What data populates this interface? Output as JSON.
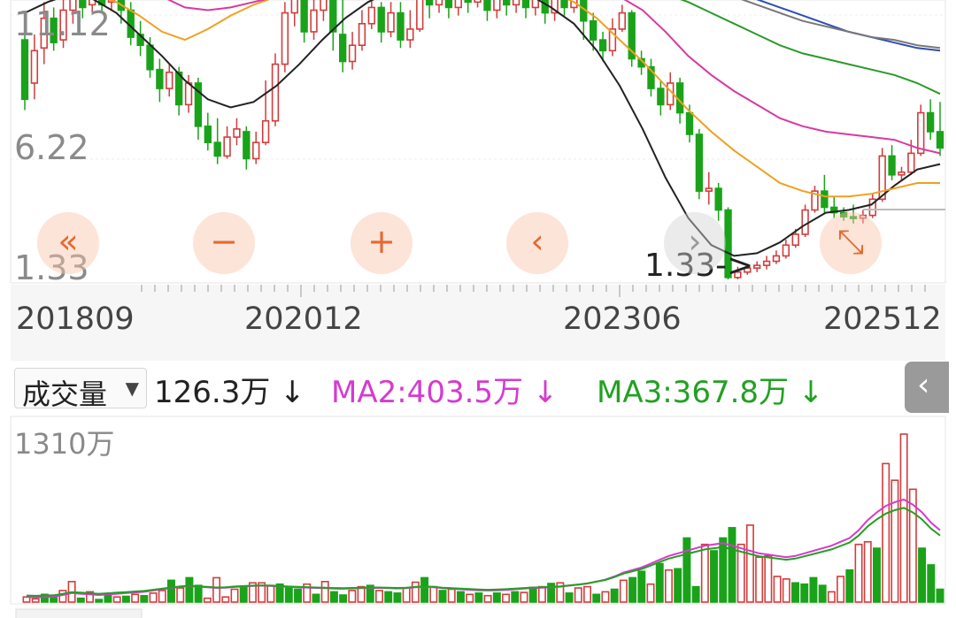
{
  "price_axis": {
    "top": "11.12",
    "mid": "6.22",
    "bottom": "1.33"
  },
  "low_marker": "1.33->",
  "date_labels": [
    "201809",
    "202012",
    "202306",
    "202512"
  ],
  "volume_panel": {
    "selector_label": "成交量",
    "selector_arrow": "▼",
    "vol_text": "126.3万 ↓",
    "ma2_text": "MA2:403.5万 ↓",
    "ma3_text": "MA3:367.8万 ↓",
    "max_label": "1310万",
    "collapse_icon": "‹"
  },
  "controls": [
    {
      "name": "fast-back",
      "icon": "«"
    },
    {
      "name": "zoom-out",
      "icon": "−"
    },
    {
      "name": "zoom-in",
      "icon": "+"
    },
    {
      "name": "back",
      "icon": "‹"
    },
    {
      "name": "forward",
      "icon": "›"
    },
    {
      "name": "expand",
      "icon": "⤡"
    }
  ],
  "colors": {
    "up": "#d23c3c",
    "down": "#1aa31a",
    "ma_black": "#222222",
    "ma_orange": "#f0a020",
    "ma_pink": "#d63aa0",
    "ma_green": "#2a9a2a",
    "ma_blue": "#2d4fb0",
    "ma_gray": "#777777"
  },
  "chart_data": [
    {
      "type": "candlestick",
      "title": "",
      "ylim": [
        1.33,
        11.12
      ],
      "x_tick_labels": [
        "201809",
        "202012",
        "202306",
        "202512"
      ],
      "candles": [
        {
          "o": 10.2,
          "c": 8.0,
          "h": 11.0,
          "l": 7.6
        },
        {
          "o": 8.6,
          "c": 9.8,
          "h": 10.4,
          "l": 8.0
        },
        {
          "o": 9.9,
          "c": 11.0,
          "h": 11.6,
          "l": 9.3
        },
        {
          "o": 11.0,
          "c": 10.1,
          "h": 11.4,
          "l": 9.8
        },
        {
          "o": 10.2,
          "c": 11.3,
          "h": 11.8,
          "l": 9.9
        },
        {
          "o": 11.3,
          "c": 11.8,
          "h": 12.0,
          "l": 10.8
        },
        {
          "o": 11.9,
          "c": 11.4,
          "h": 12.0,
          "l": 11.0
        },
        {
          "o": 11.5,
          "c": 11.9,
          "h": 12.0,
          "l": 11.2
        },
        {
          "o": 11.9,
          "c": 11.5,
          "h": 12.0,
          "l": 11.2
        },
        {
          "o": 11.6,
          "c": 11.9,
          "h": 12.0,
          "l": 11.3
        },
        {
          "o": 11.9,
          "c": 11.3,
          "h": 12.0,
          "l": 10.8
        },
        {
          "o": 11.3,
          "c": 10.3,
          "h": 11.6,
          "l": 10.0
        },
        {
          "o": 10.4,
          "c": 10.0,
          "h": 10.9,
          "l": 9.6
        },
        {
          "o": 10.0,
          "c": 9.1,
          "h": 10.3,
          "l": 8.8
        },
        {
          "o": 9.1,
          "c": 8.4,
          "h": 9.5,
          "l": 7.9
        },
        {
          "o": 8.4,
          "c": 9.0,
          "h": 9.3,
          "l": 8.1
        },
        {
          "o": 9.0,
          "c": 7.8,
          "h": 9.2,
          "l": 7.4
        },
        {
          "o": 7.8,
          "c": 8.6,
          "h": 8.9,
          "l": 7.5
        },
        {
          "o": 8.6,
          "c": 7.0,
          "h": 8.8,
          "l": 6.5
        },
        {
          "o": 7.0,
          "c": 6.4,
          "h": 7.5,
          "l": 6.1
        },
        {
          "o": 6.4,
          "c": 5.9,
          "h": 7.3,
          "l": 5.6
        },
        {
          "o": 5.9,
          "c": 6.6,
          "h": 7.0,
          "l": 5.8
        },
        {
          "o": 6.6,
          "c": 6.9,
          "h": 7.3,
          "l": 6.3
        },
        {
          "o": 6.8,
          "c": 5.8,
          "h": 7.0,
          "l": 5.4
        },
        {
          "o": 5.8,
          "c": 6.4,
          "h": 6.8,
          "l": 5.6
        },
        {
          "o": 6.4,
          "c": 7.2,
          "h": 8.7,
          "l": 6.3
        },
        {
          "o": 7.2,
          "c": 9.3,
          "h": 9.7,
          "l": 7.0
        },
        {
          "o": 9.3,
          "c": 11.2,
          "h": 11.6,
          "l": 9.0
        },
        {
          "o": 11.2,
          "c": 11.8,
          "h": 12.0,
          "l": 10.7
        },
        {
          "o": 11.8,
          "c": 10.5,
          "h": 12.0,
          "l": 10.1
        },
        {
          "o": 10.5,
          "c": 11.3,
          "h": 11.8,
          "l": 10.2
        },
        {
          "o": 11.3,
          "c": 12.0,
          "h": 12.0,
          "l": 10.9
        },
        {
          "o": 12.0,
          "c": 10.5,
          "h": 12.0,
          "l": 9.8
        },
        {
          "o": 10.4,
          "c": 9.4,
          "h": 11.8,
          "l": 9.0
        },
        {
          "o": 9.4,
          "c": 10.0,
          "h": 10.5,
          "l": 9.1
        },
        {
          "o": 10.0,
          "c": 10.8,
          "h": 11.3,
          "l": 9.8
        },
        {
          "o": 10.8,
          "c": 11.4,
          "h": 11.8,
          "l": 10.6
        },
        {
          "o": 11.4,
          "c": 10.5,
          "h": 11.6,
          "l": 10.1
        },
        {
          "o": 10.5,
          "c": 11.2,
          "h": 11.6,
          "l": 10.3
        },
        {
          "o": 11.2,
          "c": 10.2,
          "h": 11.6,
          "l": 9.9
        },
        {
          "o": 10.2,
          "c": 10.6,
          "h": 11.3,
          "l": 9.9
        },
        {
          "o": 10.6,
          "c": 11.9,
          "h": 12.0,
          "l": 10.5
        },
        {
          "o": 11.9,
          "c": 11.5,
          "h": 12.0,
          "l": 11.0
        },
        {
          "o": 11.5,
          "c": 12.0,
          "h": 12.0,
          "l": 11.2
        },
        {
          "o": 12.0,
          "c": 11.4,
          "h": 12.0,
          "l": 11.0
        },
        {
          "o": 11.4,
          "c": 12.0,
          "h": 12.0,
          "l": 11.1
        },
        {
          "o": 12.0,
          "c": 11.6,
          "h": 12.0,
          "l": 11.2
        },
        {
          "o": 11.6,
          "c": 12.0,
          "h": 12.0,
          "l": 11.4
        },
        {
          "o": 12.0,
          "c": 11.3,
          "h": 12.0,
          "l": 10.9
        },
        {
          "o": 11.3,
          "c": 12.0,
          "h": 12.0,
          "l": 11.0
        },
        {
          "o": 12.0,
          "c": 11.5,
          "h": 12.0,
          "l": 11.1
        },
        {
          "o": 11.5,
          "c": 12.0,
          "h": 12.0,
          "l": 11.2
        },
        {
          "o": 12.0,
          "c": 11.4,
          "h": 12.0,
          "l": 11.0
        },
        {
          "o": 11.4,
          "c": 12.0,
          "h": 12.0,
          "l": 11.1
        },
        {
          "o": 12.0,
          "c": 11.2,
          "h": 12.0,
          "l": 10.8
        },
        {
          "o": 11.2,
          "c": 11.9,
          "h": 12.0,
          "l": 10.9
        },
        {
          "o": 11.9,
          "c": 11.4,
          "h": 12.0,
          "l": 11.1
        },
        {
          "o": 11.4,
          "c": 12.0,
          "h": 12.0,
          "l": 11.2
        },
        {
          "o": 12.0,
          "c": 10.9,
          "h": 12.0,
          "l": 10.2
        },
        {
          "o": 10.9,
          "c": 10.2,
          "h": 11.2,
          "l": 9.8
        },
        {
          "o": 10.2,
          "c": 9.8,
          "h": 10.5,
          "l": 9.4
        },
        {
          "o": 9.8,
          "c": 10.6,
          "h": 11.0,
          "l": 9.6
        },
        {
          "o": 10.6,
          "c": 11.2,
          "h": 11.5,
          "l": 10.5
        },
        {
          "o": 11.2,
          "c": 9.5,
          "h": 11.3,
          "l": 9.2
        },
        {
          "o": 9.5,
          "c": 9.2,
          "h": 9.8,
          "l": 8.9
        },
        {
          "o": 9.2,
          "c": 8.4,
          "h": 9.5,
          "l": 8.1
        },
        {
          "o": 8.4,
          "c": 7.8,
          "h": 8.7,
          "l": 7.4
        },
        {
          "o": 7.8,
          "c": 8.6,
          "h": 9.0,
          "l": 7.6
        },
        {
          "o": 8.6,
          "c": 7.5,
          "h": 8.8,
          "l": 7.1
        },
        {
          "o": 7.5,
          "c": 6.7,
          "h": 7.8,
          "l": 6.4
        },
        {
          "o": 6.7,
          "c": 4.6,
          "h": 6.9,
          "l": 4.3
        },
        {
          "o": 4.6,
          "c": 4.7,
          "h": 5.3,
          "l": 4.1
        },
        {
          "o": 4.7,
          "c": 3.9,
          "h": 4.9,
          "l": 3.5
        },
        {
          "o": 3.9,
          "c": 1.4,
          "h": 4.0,
          "l": 1.33
        },
        {
          "o": 1.4,
          "c": 1.6,
          "h": 1.8,
          "l": 1.33
        },
        {
          "o": 1.6,
          "c": 1.75,
          "h": 1.9,
          "l": 1.5
        },
        {
          "o": 1.75,
          "c": 1.85,
          "h": 2.0,
          "l": 1.6
        },
        {
          "o": 1.85,
          "c": 2.0,
          "h": 2.2,
          "l": 1.7
        },
        {
          "o": 2.0,
          "c": 2.2,
          "h": 2.4,
          "l": 1.9
        },
        {
          "o": 2.2,
          "c": 2.6,
          "h": 2.8,
          "l": 2.1
        },
        {
          "o": 2.6,
          "c": 3.0,
          "h": 3.2,
          "l": 2.5
        },
        {
          "o": 3.0,
          "c": 3.9,
          "h": 4.1,
          "l": 2.9
        },
        {
          "o": 3.9,
          "c": 4.6,
          "h": 4.8,
          "l": 3.8
        },
        {
          "o": 4.6,
          "c": 4.0,
          "h": 5.2,
          "l": 3.8
        },
        {
          "o": 4.0,
          "c": 3.8,
          "h": 4.4,
          "l": 3.6
        },
        {
          "o": 3.8,
          "c": 3.65,
          "h": 4.0,
          "l": 3.5
        },
        {
          "o": 3.65,
          "c": 3.6,
          "h": 4.1,
          "l": 3.4
        },
        {
          "o": 3.6,
          "c": 3.7,
          "h": 3.9,
          "l": 3.4
        },
        {
          "o": 3.7,
          "c": 4.3,
          "h": 4.5,
          "l": 3.6
        },
        {
          "o": 4.3,
          "c": 5.9,
          "h": 6.2,
          "l": 4.2
        },
        {
          "o": 5.9,
          "c": 5.2,
          "h": 6.3,
          "l": 5.0
        },
        {
          "o": 5.2,
          "c": 5.3,
          "h": 5.5,
          "l": 5.0
        },
        {
          "o": 5.3,
          "c": 6.0,
          "h": 6.5,
          "l": 5.2
        },
        {
          "o": 6.0,
          "c": 7.5,
          "h": 7.8,
          "l": 5.9
        },
        {
          "o": 7.5,
          "c": 6.8,
          "h": 8.0,
          "l": 6.5
        },
        {
          "o": 6.8,
          "c": 6.2,
          "h": 7.9,
          "l": 5.9
        }
      ],
      "moving_averages": [
        {
          "color": "#222222",
          "values": [
            11.2,
            11.6,
            11.9,
            11.7,
            11.2,
            10.4,
            9.6,
            8.7,
            8.0,
            7.7,
            7.9,
            8.5,
            9.3,
            10.2,
            11.0,
            11.6,
            12.0,
            12.0,
            12.0,
            12.0,
            12.0,
            12.0,
            11.9,
            11.4,
            10.8,
            9.8,
            8.5,
            6.9,
            5.1,
            3.6,
            2.6,
            2.2,
            2.3,
            2.7,
            3.3,
            3.8,
            3.9,
            4.1,
            4.8,
            5.4,
            5.6
          ]
        },
        {
          "color": "#f0a020",
          "values": [
            12.0,
            12.0,
            12.0,
            11.9,
            11.6,
            11.1,
            10.5,
            10.2,
            10.6,
            11.1,
            11.5,
            11.8,
            12.0,
            12.0,
            12.0,
            12.0,
            12.0,
            12.0,
            12.0,
            12.0,
            12.0,
            12.0,
            12.0,
            12.0,
            11.6,
            11.0,
            10.2,
            9.4,
            8.5,
            7.6,
            6.8,
            6.1,
            5.5,
            4.9,
            4.6,
            4.4,
            4.4,
            4.5,
            4.7,
            4.9,
            4.9
          ]
        },
        {
          "color": "#d63aa0",
          "values": [
            12.0,
            12.0,
            12.0,
            12.0,
            12.0,
            12.0,
            11.8,
            11.4,
            11.3,
            11.4,
            11.6,
            11.8,
            12.0,
            12.0,
            12.0,
            12.0,
            12.0,
            12.0,
            12.0,
            12.0,
            12.0,
            12.0,
            12.0,
            12.0,
            12.0,
            12.0,
            11.8,
            11.3,
            10.5,
            9.6,
            8.9,
            8.3,
            7.8,
            7.3,
            7.0,
            6.8,
            6.7,
            6.6,
            6.5,
            6.2,
            6.0
          ]
        },
        {
          "color": "#2a9a2a",
          "values": [
            12.0,
            12.0,
            12.0,
            12.0,
            12.0,
            12.0,
            12.0,
            12.0,
            12.0,
            12.0,
            12.0,
            12.0,
            12.0,
            12.0,
            12.0,
            12.0,
            12.0,
            12.0,
            12.0,
            12.0,
            12.0,
            12.0,
            12.0,
            12.0,
            12.0,
            12.0,
            12.0,
            12.0,
            11.9,
            11.6,
            11.2,
            10.8,
            10.4,
            10.0,
            9.7,
            9.5,
            9.3,
            9.1,
            8.9,
            8.6,
            8.2
          ]
        },
        {
          "color": "#2d4fb0",
          "values": [
            12.0,
            12.0,
            12.0,
            12.0,
            12.0,
            12.0,
            12.0,
            12.0,
            12.0,
            12.0,
            12.0,
            12.0,
            12.0,
            12.0,
            12.0,
            12.0,
            12.0,
            12.0,
            12.0,
            12.0,
            12.0,
            12.0,
            12.0,
            12.0,
            12.0,
            12.0,
            12.0,
            12.0,
            12.0,
            12.0,
            12.0,
            11.9,
            11.7,
            11.4,
            11.1,
            10.8,
            10.5,
            10.3,
            10.1,
            9.9,
            9.8
          ]
        },
        {
          "color": "#777777",
          "values": [
            12.0,
            12.0,
            12.0,
            12.0,
            12.0,
            12.0,
            12.0,
            12.0,
            12.0,
            12.0,
            12.0,
            12.0,
            12.0,
            12.0,
            12.0,
            12.0,
            12.0,
            12.0,
            12.0,
            12.0,
            12.0,
            12.0,
            12.0,
            12.0,
            12.0,
            12.0,
            12.0,
            12.0,
            12.0,
            12.0,
            12.0,
            11.8,
            11.5,
            11.2,
            10.9,
            10.7,
            10.5,
            10.3,
            10.2,
            10.0,
            9.9
          ]
        }
      ]
    },
    {
      "type": "bar",
      "title": "",
      "ylim": [
        0,
        1310
      ],
      "y_unit": "万",
      "values": [
        40,
        25,
        60,
        35,
        90,
        160,
        30,
        80,
        20,
        50,
        40,
        45,
        60,
        50,
        70,
        90,
        170,
        110,
        190,
        130,
        30,
        190,
        40,
        100,
        120,
        150,
        150,
        130,
        140,
        120,
        100,
        140,
        60,
        160,
        80,
        55,
        90,
        120,
        130,
        90,
        80,
        70,
        110,
        155,
        190,
        120,
        90,
        100,
        80,
        60,
        70,
        50,
        70,
        60,
        80,
        75,
        115,
        120,
        145,
        150,
        70,
        110,
        120,
        60,
        80,
        100,
        170,
        190,
        240,
        140,
        300,
        250,
        260,
        500,
        120,
        450,
        400,
        500,
        580,
        450,
        600,
        350,
        360,
        200,
        180,
        150,
        140,
        190,
        130,
        80,
        200,
        250,
        450,
        470,
        420,
        1080,
        950,
        1310,
        880,
        420,
        290,
        100
      ],
      "ups": [
        1,
        1,
        0,
        0,
        1,
        1,
        0,
        1,
        0,
        0,
        1,
        0,
        1,
        0,
        1,
        1,
        0,
        1,
        0,
        0,
        1,
        1,
        1,
        1,
        0,
        1,
        1,
        1,
        0,
        0,
        0,
        1,
        0,
        1,
        0,
        0,
        1,
        1,
        0,
        1,
        0,
        0,
        1,
        1,
        0,
        1,
        0,
        1,
        0,
        1,
        0,
        1,
        0,
        1,
        0,
        1,
        0,
        1,
        0,
        1,
        0,
        1,
        1,
        0,
        1,
        0,
        1,
        0,
        0,
        1,
        0,
        1,
        0,
        0,
        0,
        1,
        0,
        0,
        0,
        1,
        1,
        1,
        1,
        1,
        1,
        0,
        0,
        0,
        0,
        1,
        1,
        0,
        1,
        1,
        0,
        1,
        1,
        1,
        1,
        0,
        0,
        0
      ],
      "ma2": [
        40,
        38,
        40,
        42,
        55,
        70,
        65,
        60,
        55,
        60,
        65,
        70,
        75,
        80,
        90,
        100,
        110,
        120,
        125,
        120,
        115,
        110,
        112,
        118,
        122,
        126,
        128,
        126,
        122,
        118,
        115,
        113,
        110,
        108,
        105,
        104,
        106,
        108,
        110,
        110,
        108,
        106,
        108,
        115,
        120,
        115,
        108,
        104,
        100,
        96,
        92,
        90,
        92,
        95,
        100,
        105,
        110,
        112,
        115,
        120,
        128,
        136,
        145,
        160,
        175,
        200,
        230,
        250,
        270,
        300,
        330,
        360,
        380,
        400,
        420,
        440,
        450,
        460,
        440,
        420,
        400,
        380,
        370,
        360,
        350,
        360,
        380,
        400,
        420,
        440,
        470,
        500,
        560,
        640,
        700,
        750,
        780,
        800,
        760,
        700,
        620,
        560
      ]
    }
  ]
}
